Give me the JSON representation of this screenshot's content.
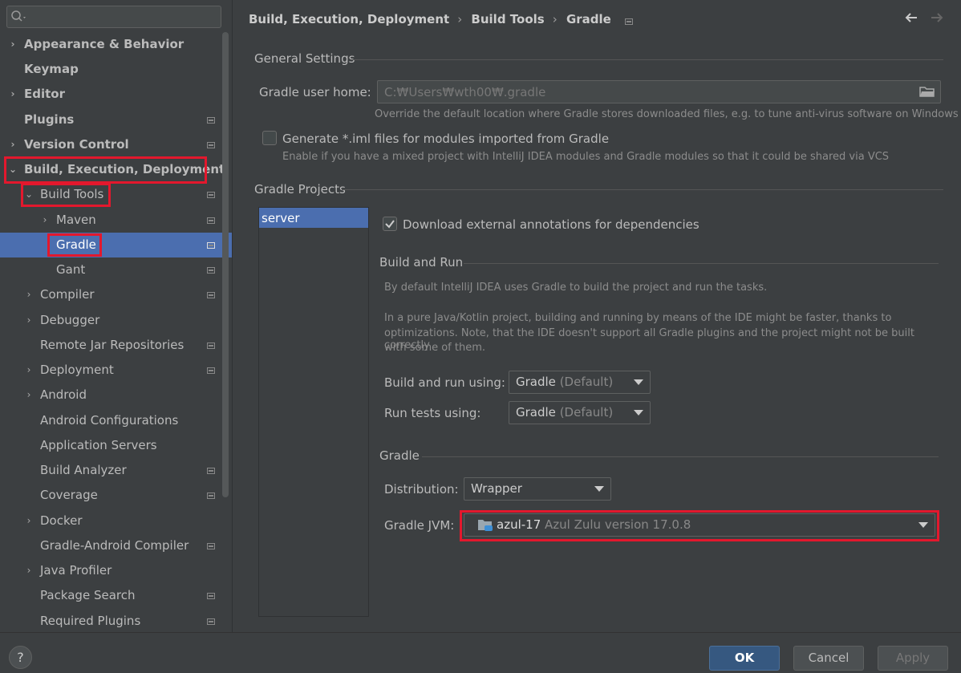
{
  "search": {
    "placeholder": ""
  },
  "sidebar": {
    "items": [
      {
        "label": "Appearance & Behavior"
      },
      {
        "label": "Keymap"
      },
      {
        "label": "Editor"
      },
      {
        "label": "Plugins"
      },
      {
        "label": "Version Control"
      },
      {
        "label": "Build, Execution, Deployment"
      },
      {
        "label": "Build Tools"
      },
      {
        "label": "Maven"
      },
      {
        "label": "Gradle"
      },
      {
        "label": "Gant"
      },
      {
        "label": "Compiler"
      },
      {
        "label": "Debugger"
      },
      {
        "label": "Remote Jar Repositories"
      },
      {
        "label": "Deployment"
      },
      {
        "label": "Android"
      },
      {
        "label": "Android Configurations"
      },
      {
        "label": "Application Servers"
      },
      {
        "label": "Build Analyzer"
      },
      {
        "label": "Coverage"
      },
      {
        "label": "Docker"
      },
      {
        "label": "Gradle-Android Compiler"
      },
      {
        "label": "Java Profiler"
      },
      {
        "label": "Package Search"
      },
      {
        "label": "Required Plugins"
      }
    ]
  },
  "breadcrumb": [
    "Build, Execution, Deployment",
    "Build Tools",
    "Gradle"
  ],
  "general": {
    "title": "General Settings",
    "user_home_label": "Gradle user home:",
    "user_home_placeholder": "C:₩Users₩wth00₩.gradle",
    "user_home_hint": "Override the default location where Gradle stores downloaded files, e.g. to tune anti-virus software on Windows",
    "iml_label": "Generate *.iml files for modules imported from Gradle",
    "iml_hint": "Enable if you have a mixed project with IntelliJ IDEA modules and Gradle modules so that it could be shared via VCS"
  },
  "projects": {
    "title": "Gradle Projects",
    "list": [
      "server"
    ],
    "download_annotations": "Download external annotations for dependencies"
  },
  "build_run": {
    "title": "Build and Run",
    "desc1": "By default IntelliJ IDEA uses Gradle to build the project and run the tasks.",
    "desc2_line1": "In a pure Java/Kotlin project, building and running by means of the IDE might be faster, thanks to",
    "desc2_line2": "optimizations. Note, that the IDE doesn't support all Gradle plugins and the project might not be built correctly",
    "desc2_line3": "with some of them.",
    "build_label": "Build and run using:",
    "build_value": "Gradle",
    "build_suffix": "(Default)",
    "tests_label": "Run tests using:",
    "tests_value": "Gradle",
    "tests_suffix": "(Default)"
  },
  "gradle": {
    "title": "Gradle",
    "distribution_label": "Distribution:",
    "distribution_value": "Wrapper",
    "jvm_label": "Gradle JVM:",
    "jvm_value": "azul-17",
    "jvm_detail": "Azul Zulu version 17.0.8"
  },
  "footer": {
    "help": "?",
    "ok": "OK",
    "cancel": "Cancel",
    "apply": "Apply"
  },
  "colors": {
    "selection": "#4b6eaf",
    "highlight_box": "#e3182d",
    "background": "#3c3f41"
  }
}
